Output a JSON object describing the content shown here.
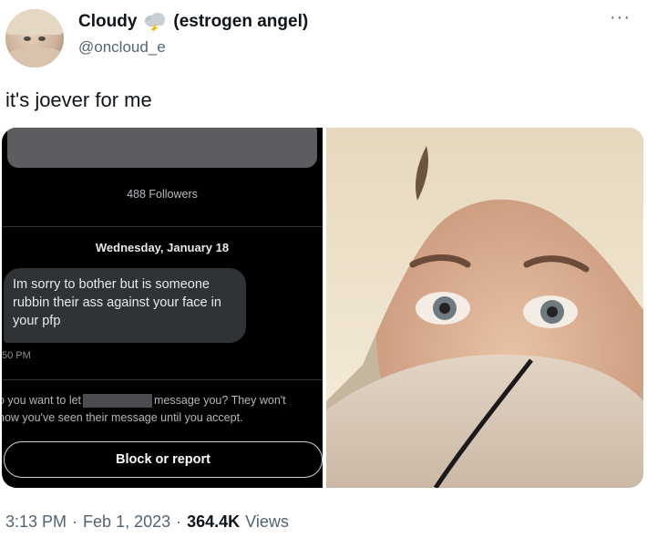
{
  "author": {
    "display_name": "Cloudy",
    "name_suffix": "(estrogen angel)",
    "handle": "@oncloud_e",
    "avatar_icon": "profile-photo",
    "badge_icon": "storm-cloud-emoji"
  },
  "tweet": {
    "text": "it's joever for me"
  },
  "screenshot": {
    "followers": "488 Followers",
    "date": "Wednesday, January 18",
    "message": "Im sorry to bother but is someone rubbin their ass against your face in your pfp",
    "time": "50 PM",
    "request_part1": "o you want to let",
    "request_part2": "message you? They won't",
    "request_line2": "now you've seen their message until you accept.",
    "block_label": "Block or report"
  },
  "meta": {
    "time": "3:13 PM",
    "separator": "·",
    "date": "Feb 1, 2023",
    "views_count": "364.4K",
    "views_label": "Views"
  },
  "colors": {
    "accent_text": "#0f1419",
    "secondary_text": "#536471",
    "dm_background": "#000000",
    "dm_bubble": "#2f3336"
  }
}
